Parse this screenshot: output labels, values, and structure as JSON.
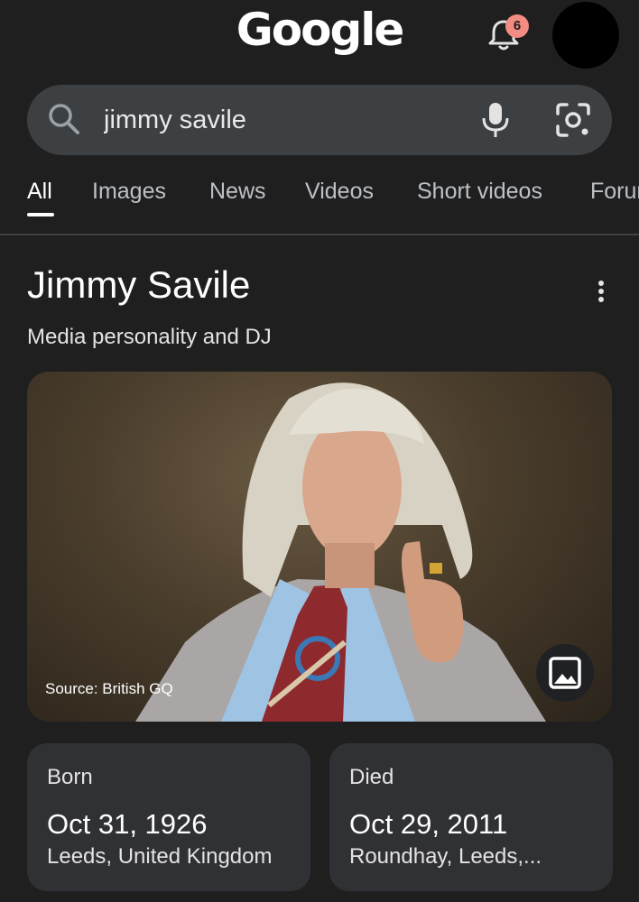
{
  "header": {
    "logo_text": "Google",
    "notification_count": "6"
  },
  "search": {
    "query": "jimmy savile"
  },
  "tabs": [
    {
      "label": "All",
      "active": true
    },
    {
      "label": "Images"
    },
    {
      "label": "News"
    },
    {
      "label": "Videos"
    },
    {
      "label": "Short videos"
    },
    {
      "label": "Forums"
    }
  ],
  "knowledge_panel": {
    "title": "Jimmy Savile",
    "subtitle": "Media personality and DJ",
    "image_source": "Source: British GQ",
    "facts": [
      {
        "label": "Born",
        "date": "Oct 31, 1926",
        "place": "Leeds, United Kingdom"
      },
      {
        "label": "Died",
        "date": "Oct 29, 2011",
        "place": "Roundhay, Leeds,..."
      }
    ]
  },
  "colors": {
    "background": "#1f1f1f",
    "search_bar": "#3c4043",
    "card": "#303134",
    "badge": "#f28b82",
    "tab_active": "#ffffff",
    "tab_inactive": "#bdc1c6"
  },
  "icons": [
    "bell-icon",
    "search-icon",
    "mic-icon",
    "lens-icon",
    "more-vert-icon",
    "image-gallery-icon"
  ]
}
